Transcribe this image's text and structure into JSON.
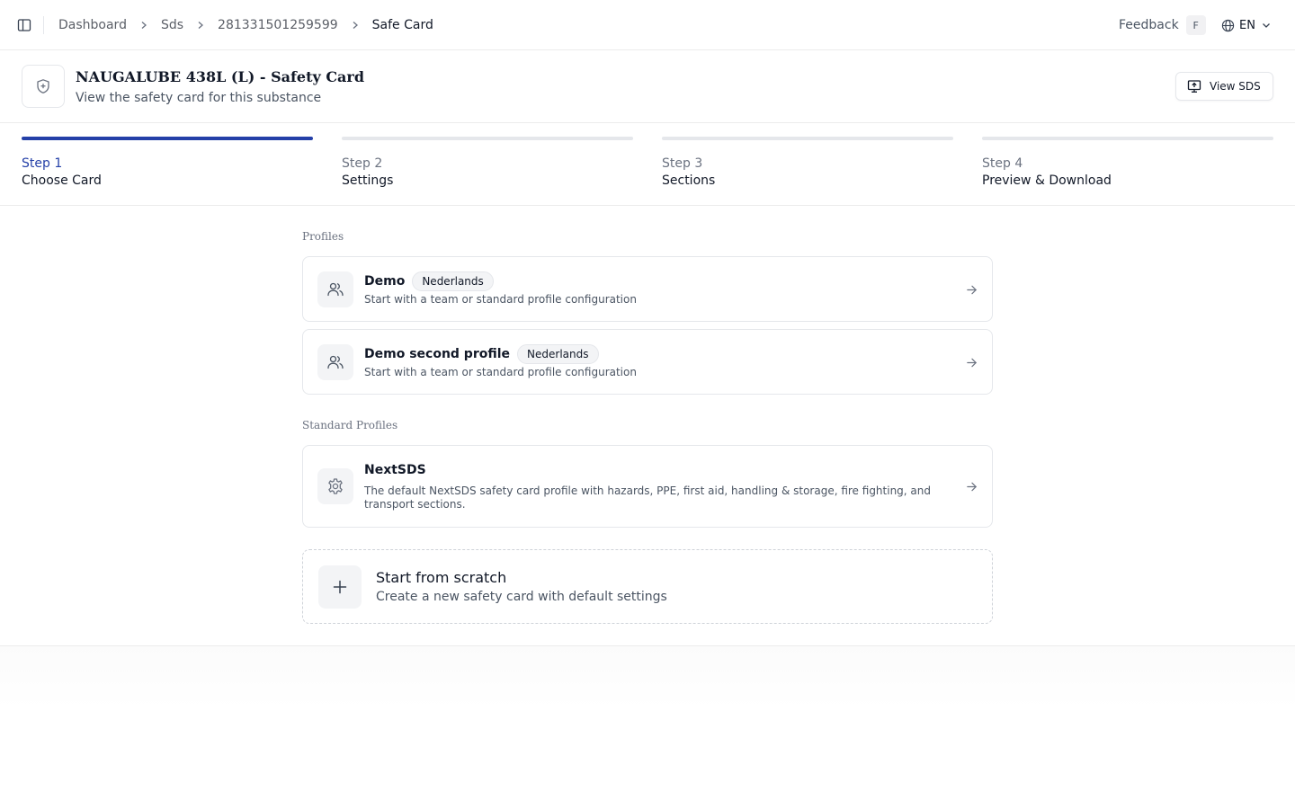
{
  "breadcrumb": {
    "items": [
      "Dashboard",
      "Sds",
      "281331501259599"
    ],
    "current": "Safe Card"
  },
  "topbar": {
    "feedback_label": "Feedback",
    "feedback_shortcut": "F",
    "language": "EN"
  },
  "header": {
    "title": "NAUGALUBE 438L (L) - Safety Card",
    "subtitle": "View the safety card for this substance",
    "view_sds_label": "View SDS"
  },
  "stepper": {
    "steps": [
      {
        "num": "Step 1",
        "name": "Choose Card",
        "active": true
      },
      {
        "num": "Step 2",
        "name": "Settings",
        "active": false
      },
      {
        "num": "Step 3",
        "name": "Sections",
        "active": false
      },
      {
        "num": "Step 4",
        "name": "Preview & Download",
        "active": false
      }
    ]
  },
  "profiles": {
    "label": "Profiles",
    "items": [
      {
        "title": "Demo",
        "badge": "Nederlands",
        "description": "Start with a team or standard profile configuration"
      },
      {
        "title": "Demo second profile",
        "badge": "Nederlands",
        "description": "Start with a team or standard profile configuration"
      }
    ]
  },
  "standard_profiles": {
    "label": "Standard Profiles",
    "items": [
      {
        "title": "NextSDS",
        "description": "The default NextSDS safety card profile with hazards, PPE, first aid, handling & storage, fire fighting, and transport sections."
      }
    ]
  },
  "scratch": {
    "title": "Start from scratch",
    "description": "Create a new safety card with default settings"
  },
  "colors": {
    "accent": "#2540a8",
    "border": "#e5e7eb",
    "muted_text": "#4b5563"
  }
}
